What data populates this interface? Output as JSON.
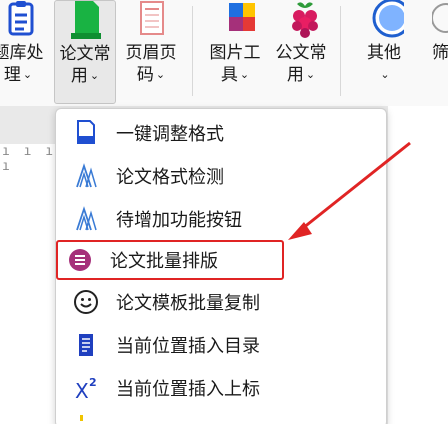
{
  "ribbon": {
    "groups": [
      {
        "id": "tiku",
        "line1": "题库处",
        "line2": "理",
        "has_chevron": true
      },
      {
        "id": "lunwen",
        "line1": "论文常",
        "line2": "用",
        "has_chevron": true
      },
      {
        "id": "yemei",
        "line1": "页眉页",
        "line2": "码",
        "has_chevron": true
      },
      {
        "id": "tupian",
        "line1": "图片工",
        "line2": "具",
        "has_chevron": true
      },
      {
        "id": "gongwen",
        "line1": "公文常",
        "line2": "用",
        "has_chevron": true
      },
      {
        "id": "qita",
        "line1": "其他",
        "line2": "",
        "has_chevron": true
      },
      {
        "id": "more",
        "line1": "筛",
        "line2": "",
        "has_chevron": false
      }
    ],
    "chevron": "⌄"
  },
  "ruler_text": "ı ı ı ı",
  "menu": {
    "items": [
      {
        "label": "一键调整格式",
        "icon": "blue-document-icon"
      },
      {
        "label": "论文格式检测",
        "icon": "compass-lines-icon"
      },
      {
        "label": "待增加功能按钮",
        "icon": "compass-lines-icon"
      },
      {
        "label": "论文批量排版",
        "icon": "purple-list-circle-icon",
        "highlighted": true
      },
      {
        "label": "论文模板批量复制",
        "icon": "smiley-icon"
      },
      {
        "label": "当前位置插入目录",
        "icon": "toc-document-icon"
      },
      {
        "label": "当前位置插入上标",
        "icon": "superscript-icon"
      }
    ]
  },
  "colors": {
    "highlight_border": "#e02424",
    "arrow": "#e02424",
    "accent_blue": "#1f4fd1",
    "purple": "#a5307a"
  }
}
